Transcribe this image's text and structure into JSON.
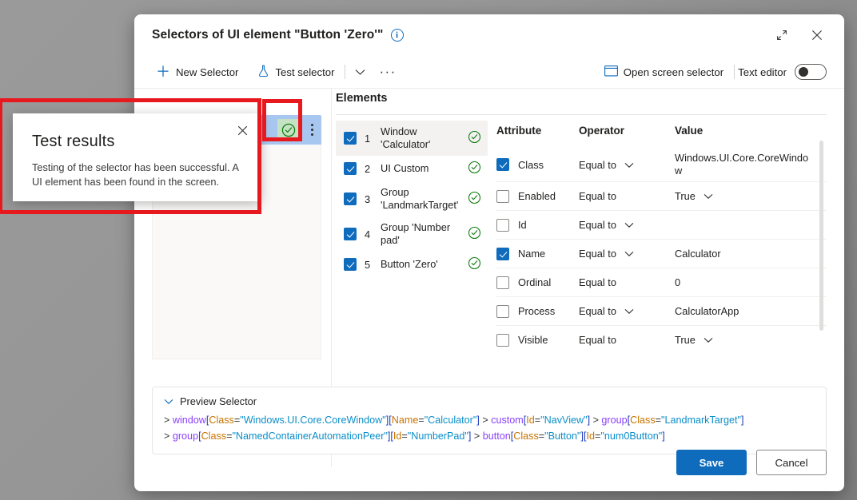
{
  "dialog": {
    "title": "Selectors of UI element \"Button 'Zero'\"",
    "info_icon": "info-icon",
    "expand_label": "Expand",
    "close_label": "Close"
  },
  "commandbar": {
    "new_selector": "New Selector",
    "test_selector": "Test selector",
    "more_label": "···",
    "open_screen_selector": "Open screen selector",
    "text_editor": "Text editor",
    "text_editor_on": false
  },
  "left_panel": {
    "status": "success",
    "kebab_label": "More options"
  },
  "elements": {
    "header": "Elements",
    "items": [
      {
        "index": "1",
        "label": "Window 'Calculator'",
        "checked": true,
        "status": "ok",
        "selected": true
      },
      {
        "index": "2",
        "label": "UI Custom",
        "checked": true,
        "status": "ok",
        "selected": false
      },
      {
        "index": "3",
        "label": "Group 'LandmarkTarget'",
        "checked": true,
        "status": "ok",
        "selected": false
      },
      {
        "index": "4",
        "label": "Group 'Number pad'",
        "checked": true,
        "status": "ok",
        "selected": false
      },
      {
        "index": "5",
        "label": "Button 'Zero'",
        "checked": true,
        "status": "ok",
        "selected": false
      }
    ]
  },
  "attributes": {
    "columns": {
      "attribute": "Attribute",
      "operator": "Operator",
      "value": "Value"
    },
    "rows": [
      {
        "name": "Class",
        "checked": true,
        "operator": "Equal to",
        "operator_dropdown": true,
        "value": "Windows.UI.Core.CoreWindow",
        "value_dropdown": false
      },
      {
        "name": "Enabled",
        "checked": false,
        "operator": "Equal to",
        "operator_dropdown": false,
        "value": "True",
        "value_dropdown": true
      },
      {
        "name": "Id",
        "checked": false,
        "operator": "Equal to",
        "operator_dropdown": true,
        "value": "",
        "value_dropdown": false
      },
      {
        "name": "Name",
        "checked": true,
        "operator": "Equal to",
        "operator_dropdown": true,
        "value": "Calculator",
        "value_dropdown": false
      },
      {
        "name": "Ordinal",
        "checked": false,
        "operator": "Equal to",
        "operator_dropdown": false,
        "value": "0",
        "value_dropdown": false
      },
      {
        "name": "Process",
        "checked": false,
        "operator": "Equal to",
        "operator_dropdown": true,
        "value": "CalculatorApp",
        "value_dropdown": false
      },
      {
        "name": "Visible",
        "checked": false,
        "operator": "Equal to",
        "operator_dropdown": false,
        "value": "True",
        "value_dropdown": true
      }
    ]
  },
  "preview": {
    "label": "Preview Selector",
    "expanded": true,
    "line1": "> window[Class=\"Windows.UI.Core.CoreWindow\"][Name=\"Calculator\"] > custom[Id=\"NavView\"] > group[Class=\"LandmarkTarget\"]",
    "line2": "> group[Class=\"NamedContainerAutomationPeer\"][Id=\"NumberPad\"] > button[Class=\"Button\"][Id=\"num0Button\"]"
  },
  "footer": {
    "save": "Save",
    "cancel": "Cancel"
  },
  "test_results": {
    "title": "Test results",
    "message": "Testing of the selector has been successful. A UI element has been found in the screen.",
    "close_label": "Close"
  },
  "colors": {
    "accent": "#0f6cbd",
    "success": "#107c10",
    "success_bg": "#c5e3c4",
    "selected_row": "#a8c7f0",
    "annotation": "#e8181f"
  }
}
